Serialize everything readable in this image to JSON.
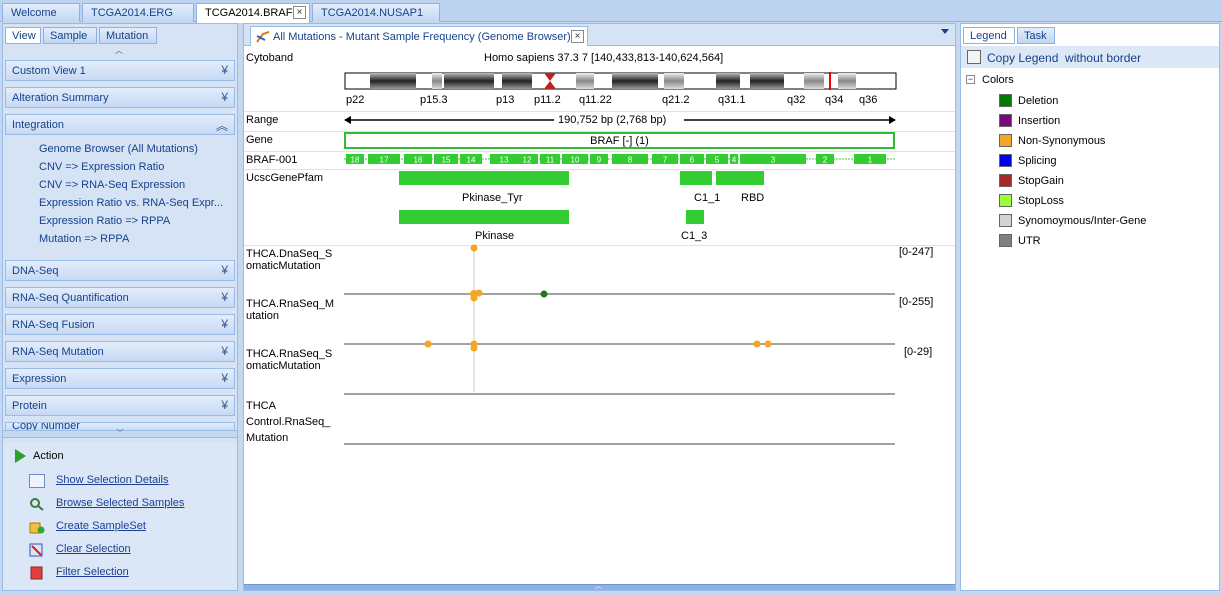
{
  "doc_tabs": [
    {
      "label": "Welcome"
    },
    {
      "label": "TCGA2014.ERG"
    },
    {
      "label": "TCGA2014.BRAF"
    },
    {
      "label": "TCGA2014.NUSAP1"
    }
  ],
  "left": {
    "tabs": [
      "View",
      "Sample",
      "Mutation"
    ],
    "groups": {
      "custom_view": "Custom View 1",
      "alteration": "Alteration Summary",
      "integration": "Integration",
      "dnaseq": "DNA-Seq",
      "rnaseq_quant": "RNA-Seq Quantification",
      "rnaseq_fusion": "RNA-Seq Fusion",
      "rnaseq_mut": "RNA-Seq Mutation",
      "expression": "Expression",
      "protein": "Protein",
      "copy": "Copy Number"
    },
    "integration_items": [
      "Genome Browser (All Mutations)",
      "CNV => Expression Ratio",
      "CNV => RNA-Seq Expression",
      "Expression Ratio vs. RNA-Seq Expr...",
      "Expression Ratio => RPPA",
      "Mutation => RPPA"
    ],
    "action_title": "Action",
    "actions": [
      "Show Selection Details",
      "Browse Selected Samples",
      "Create SampleSet",
      "Clear Selection",
      "Filter Selection"
    ]
  },
  "center": {
    "tab_label": "All Mutations - Mutant Sample Frequency (Genome Browser)",
    "cytoband_label": "Cytoband",
    "assembly": "Homo sapiens 37.3 7 [140,433,813-140,624,564]",
    "bands": [
      "p22",
      "p15.3",
      "p13",
      "p11.2",
      "q11.22",
      "q21.2",
      "q31.1",
      "q32",
      "q34",
      "q36"
    ],
    "range_label": "Range",
    "range_text": "190,752 bp (2,768 bp)",
    "gene_label": "Gene",
    "gene_text": "BRAF [-] (1)",
    "transcript_label": "BRAF-001",
    "exons": [
      "18",
      "17",
      "16",
      "15",
      "14",
      "13",
      "12",
      "11",
      "10",
      "9",
      "8",
      "7",
      "6",
      "5",
      "4",
      "3",
      "2",
      "1"
    ],
    "pfam_label": "UcscGenePfam",
    "domains": [
      "Pkinase_Tyr",
      "C1_1",
      "RBD",
      "Pkinase",
      "C1_3"
    ],
    "tracks": [
      {
        "label_line1": "THCA.DnaSeq_S",
        "label_line2": "omaticMutation",
        "range": "[0-247]"
      },
      {
        "label_line1": "THCA.RnaSeq_M",
        "label_line2": "utation",
        "range": "[0-255]"
      },
      {
        "label_line1": "THCA.RnaSeq_S",
        "label_line2": "omaticMutation",
        "range": "[0-29]"
      },
      {
        "label_line1": "THCA",
        "label_line2": "Control.RnaSeq_",
        "label_line3": "Mutation",
        "range": ""
      }
    ]
  },
  "right": {
    "tabs": [
      "Legend",
      "Task"
    ],
    "copy_label": "Copy Legend  without border",
    "colors_title": "Colors",
    "legend": [
      {
        "label": "Deletion",
        "color": "#007a00"
      },
      {
        "label": "Insertion",
        "color": "#7a0a7a"
      },
      {
        "label": "Non-Synonymous",
        "color": "#f5a623"
      },
      {
        "label": "Splicing",
        "color": "#0000ee"
      },
      {
        "label": "StopGain",
        "color": "#a52a2a"
      },
      {
        "label": "StopLoss",
        "color": "#9aff3a"
      },
      {
        "label": "Synomoymous/Inter-Gene",
        "color": "#d3d3d3"
      },
      {
        "label": "UTR",
        "color": "#808080"
      }
    ]
  }
}
